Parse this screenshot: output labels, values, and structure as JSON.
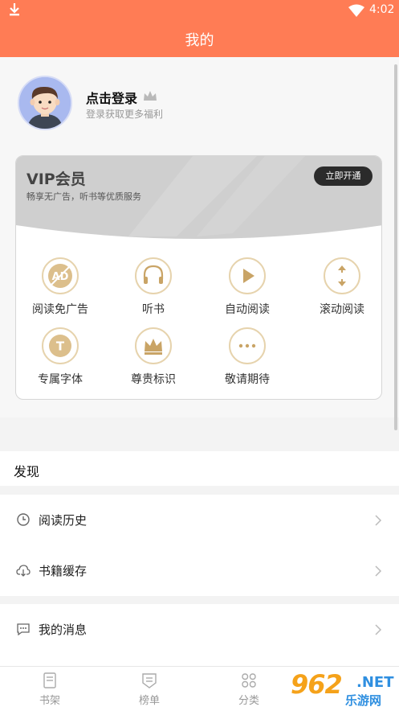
{
  "status_bar": {
    "time": "4:02",
    "download_icon": "download-icon",
    "wifi_icon": "wifi-icon"
  },
  "header": {
    "title": "我的"
  },
  "profile": {
    "login_title": "点击登录",
    "login_subtitle": "登录获取更多福利",
    "avatar_icon": "user-avatar",
    "badge_icon": "crown-badge-icon"
  },
  "vip": {
    "title": "VIP会员",
    "description": "畅享无广告，听书等优质服务",
    "open_button": "立即开通",
    "benefits": [
      {
        "label": "阅读免广告",
        "icon": "ad-free-icon"
      },
      {
        "label": "听书",
        "icon": "headphones-icon"
      },
      {
        "label": "自动阅读",
        "icon": "play-icon"
      },
      {
        "label": "滚动阅读",
        "icon": "scroll-icon"
      },
      {
        "label": "专属字体",
        "icon": "font-icon"
      },
      {
        "label": "尊贵标识",
        "icon": "crown-icon"
      },
      {
        "label": "敬请期待",
        "icon": "more-icon"
      }
    ]
  },
  "discover": {
    "title": "发现"
  },
  "menu": [
    {
      "label": "阅读历史",
      "icon": "clock-icon"
    },
    {
      "label": "书籍缓存",
      "icon": "cloud-download-icon"
    },
    {
      "label": "我的消息",
      "icon": "message-icon"
    }
  ],
  "tabs": [
    {
      "label": "书架",
      "icon": "bookshelf-icon"
    },
    {
      "label": "榜单",
      "icon": "ranking-icon"
    },
    {
      "label": "分类",
      "icon": "category-icon"
    }
  ],
  "watermark": {
    "number": "962",
    "suffix": ".NET",
    "text": "乐游网"
  },
  "colors": {
    "brand": "#ff7c55",
    "gold": "#d9b57a",
    "dark_button": "#2b2b2b"
  }
}
